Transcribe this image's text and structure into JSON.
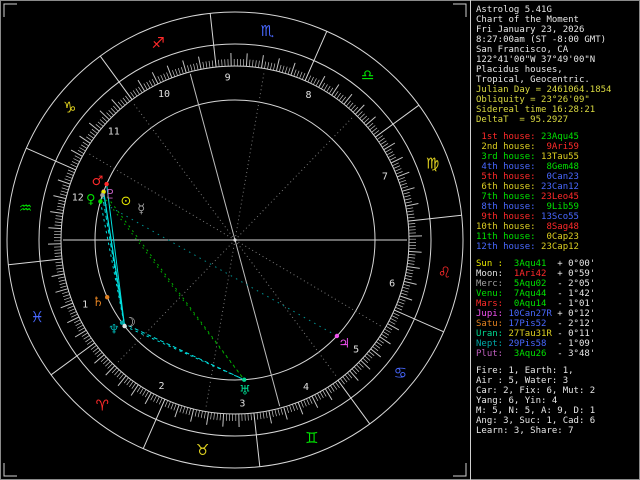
{
  "colors": {
    "background": "#000000",
    "foreground": "#e6e6e6",
    "tech_text": "#d8d840",
    "fire": "#ff2a2a",
    "earth": "#ddcf20",
    "air": "#00e100",
    "water": "#4868ff",
    "ring": "#d8d8d8",
    "tick": "#c4c4c4",
    "cusp_axis": "#d8d8d8",
    "cusp_minor": "#7a7a7a",
    "house_number": "#e0e0e0",
    "border": "#cfcfcf",
    "aspect_sextile": "#00dede",
    "aspect_trine": "#00b400",
    "aspect_conjunct": "#dede40",
    "aspect_inconjunct": "#009090"
  },
  "sidebar": {
    "header_lines": [
      {
        "text": "Astrolog 5.41G",
        "color": "#e6e6e6"
      },
      {
        "text": "Chart of the Moment",
        "color": "#e6e6e6"
      },
      {
        "text": "Fri January 23, 2026",
        "color": "#e6e6e6"
      },
      {
        "text": "8:27:00am (ST -8:00 GMT)",
        "color": "#e6e6e6"
      },
      {
        "text": "San Francisco, CA",
        "color": "#e6e6e6"
      },
      {
        "text": "122°41'00\"W 37°49'00\"N",
        "color": "#e6e6e6"
      },
      {
        "text": "Placidus houses,",
        "color": "#e6e6e6"
      },
      {
        "text": "Tropical, Geocentric.",
        "color": "#e6e6e6"
      },
      {
        "text": "Julian Day = 2461064.1854",
        "color": "#d8d840"
      },
      {
        "text": "Obliquity = 23°26'09\"",
        "color": "#d8d840"
      },
      {
        "text": "Sidereal time 16:28:21",
        "color": "#d8d840"
      },
      {
        "text": "DeltaT  = 95.2927",
        "color": "#d8d840"
      }
    ],
    "houses": [
      {
        "label": " 1st house:",
        "value": "23Aqu45",
        "label_color": "#ff2a2a",
        "value_color": "#00e100"
      },
      {
        "label": " 2nd house:",
        "value": " 9Ari59",
        "label_color": "#ddcf20",
        "value_color": "#ff2a2a"
      },
      {
        "label": " 3rd house:",
        "value": "13Tau55",
        "label_color": "#00e100",
        "value_color": "#ddcf20"
      },
      {
        "label": " 4th house:",
        "value": " 8Gem48",
        "label_color": "#4868ff",
        "value_color": "#00e100"
      },
      {
        "label": " 5th house:",
        "value": " 0Can23",
        "label_color": "#ff2a2a",
        "value_color": "#4868ff"
      },
      {
        "label": " 6th house:",
        "value": "23Can12",
        "label_color": "#ddcf20",
        "value_color": "#4868ff"
      },
      {
        "label": " 7th house:",
        "value": "23Leo45",
        "label_color": "#00e100",
        "value_color": "#ff2a2a"
      },
      {
        "label": " 8th house:",
        "value": " 9Lib59",
        "label_color": "#4868ff",
        "value_color": "#00e100"
      },
      {
        "label": " 9th house:",
        "value": "13Sco55",
        "label_color": "#ff2a2a",
        "value_color": "#4868ff"
      },
      {
        "label": "10th house:",
        "value": " 8Sag48",
        "label_color": "#ddcf20",
        "value_color": "#ff2a2a"
      },
      {
        "label": "11th house:",
        "value": " 0Cap23",
        "label_color": "#00e100",
        "value_color": "#ddcf20"
      },
      {
        "label": "12th house:",
        "value": "23Cap12",
        "label_color": "#4868ff",
        "value_color": "#ddcf20"
      }
    ],
    "planets": [
      {
        "name": "Sun :",
        "pos": " 3Aqu41  ",
        "vel": "+ 0°00'",
        "name_color": "#e8e800",
        "pos_color": "#00e100"
      },
      {
        "name": "Moon:",
        "pos": " 1Ari42  ",
        "vel": "+ 0°59'",
        "name_color": "#e0e0e0",
        "pos_color": "#ff2a2a"
      },
      {
        "name": "Merc:",
        "pos": " 5Aqu02  ",
        "vel": "- 2°05'",
        "name_color": "#a0a0a0",
        "pos_color": "#00e100"
      },
      {
        "name": "Venu:",
        "pos": " 7Aqu44  ",
        "vel": "- 1°42'",
        "name_color": "#00e100",
        "pos_color": "#00e100"
      },
      {
        "name": "Mars:",
        "pos": " 0Aqu14  ",
        "vel": "- 1°01'",
        "name_color": "#ff2a2a",
        "pos_color": "#00e100"
      },
      {
        "name": "Jupi:",
        "pos": "10Can27R ",
        "vel": "+ 0°12'",
        "name_color": "#f050f0",
        "pos_color": "#4868ff"
      },
      {
        "name": "Satu:",
        "pos": "17Pis52  ",
        "vel": "- 2°12'",
        "name_color": "#e08020",
        "pos_color": "#4868ff"
      },
      {
        "name": "Uran:",
        "pos": "27Tau31R ",
        "vel": "- 0°11'",
        "name_color": "#00d890",
        "pos_color": "#ddcf20"
      },
      {
        "name": "Nept:",
        "pos": "29Pis58  ",
        "vel": "- 1°09'",
        "name_color": "#00a8a8",
        "pos_color": "#4868ff"
      },
      {
        "name": "Plut:",
        "pos": " 3Aqu26  ",
        "vel": "- 3°48'",
        "name_color": "#c060c0",
        "pos_color": "#00e100"
      }
    ],
    "tallies": [
      "Fire: 1, Earth: 1,",
      "Air : 5, Water: 3",
      "Car: 2, Fix: 6, Mut: 2",
      "Yang: 6, Yin: 4",
      "M: 5, N: 5, A: 9, D: 1",
      "Ang: 3, Suc: 1, Cad: 6",
      "Learn: 3, Share: 7"
    ]
  },
  "wheel": {
    "ascendant": 323.75,
    "cusps": [
      323.75,
      9.98,
      43.92,
      68.8,
      90.38,
      113.2,
      143.75,
      189.98,
      223.92,
      248.8,
      270.38,
      293.2
    ],
    "signs": [
      {
        "name": "aries",
        "glyph": "♈",
        "color": "#ff2a2a"
      },
      {
        "name": "taurus",
        "glyph": "♉",
        "color": "#ddcf20"
      },
      {
        "name": "gemini",
        "glyph": "♊",
        "color": "#00e100"
      },
      {
        "name": "cancer",
        "glyph": "♋",
        "color": "#4868ff"
      },
      {
        "name": "leo",
        "glyph": "♌",
        "color": "#ff2a2a"
      },
      {
        "name": "virgo",
        "glyph": "♍",
        "color": "#ddcf20"
      },
      {
        "name": "libra",
        "glyph": "♎",
        "color": "#00e100"
      },
      {
        "name": "scorpio",
        "glyph": "♏",
        "color": "#4868ff"
      },
      {
        "name": "sagittarius",
        "glyph": "♐",
        "color": "#ff2a2a"
      },
      {
        "name": "capricorn",
        "glyph": "♑",
        "color": "#ddcf20"
      },
      {
        "name": "aquarius",
        "glyph": "♒",
        "color": "#00e100"
      },
      {
        "name": "pisces",
        "glyph": "♓",
        "color": "#4868ff"
      }
    ],
    "planets": [
      {
        "name": "sun",
        "glyph": "⊙",
        "lon": 303.68,
        "color": "#e8e800"
      },
      {
        "name": "moon",
        "glyph": "☽",
        "lon": 1.7,
        "color": "#e0e0e0"
      },
      {
        "name": "mercury",
        "glyph": "☿",
        "lon": 305.03,
        "color": "#a0a0a0"
      },
      {
        "name": "venus",
        "glyph": "♀",
        "lon": 307.73,
        "color": "#00e100"
      },
      {
        "name": "mars",
        "glyph": "♂",
        "lon": 300.23,
        "color": "#ff2a2a"
      },
      {
        "name": "jupiter",
        "glyph": "♃",
        "lon": 100.45,
        "color": "#f050f0"
      },
      {
        "name": "saturn",
        "glyph": "♄",
        "lon": 347.87,
        "color": "#e08020"
      },
      {
        "name": "uranus",
        "glyph": "♅",
        "lon": 57.52,
        "color": "#00d890"
      },
      {
        "name": "neptune",
        "glyph": "♆",
        "lon": 359.97,
        "color": "#00a8a8"
      },
      {
        "name": "pluto",
        "glyph": "♇",
        "lon": 303.43,
        "color": "#c060c0"
      }
    ],
    "aspects": [
      {
        "a": "sun",
        "b": "moon",
        "color": "#00dede",
        "dash": ""
      },
      {
        "a": "mars",
        "b": "moon",
        "color": "#00dede",
        "dash": ""
      },
      {
        "a": "pluto",
        "b": "moon",
        "color": "#00dede",
        "dash": ""
      },
      {
        "a": "mercury",
        "b": "moon",
        "color": "#00dede",
        "dash": "4 3"
      },
      {
        "a": "venus",
        "b": "moon",
        "color": "#00dede",
        "dash": "2.5 3.5"
      },
      {
        "a": "moon",
        "b": "uranus",
        "color": "#00dede",
        "dash": "2.5 3.5"
      },
      {
        "a": "neptune",
        "b": "uranus",
        "color": "#00dede",
        "dash": "4 3"
      },
      {
        "a": "sun",
        "b": "uranus",
        "color": "#00b400",
        "dash": "2 4"
      },
      {
        "a": "mercury",
        "b": "uranus",
        "color": "#00b400",
        "dash": "1.5 4.5"
      },
      {
        "a": "venus",
        "b": "jupiter",
        "color": "#009090",
        "dash": "1.5 4.5"
      },
      {
        "a": "sun",
        "b": "pluto",
        "color": "#dede40",
        "dash": ""
      },
      {
        "a": "sun",
        "b": "mercury",
        "color": "#dede40",
        "dash": "4 3"
      },
      {
        "a": "mercury",
        "b": "venus",
        "color": "#dede40",
        "dash": "2.5 3.5"
      },
      {
        "a": "moon",
        "b": "neptune",
        "color": "#dede40",
        "dash": "4 3"
      }
    ]
  }
}
